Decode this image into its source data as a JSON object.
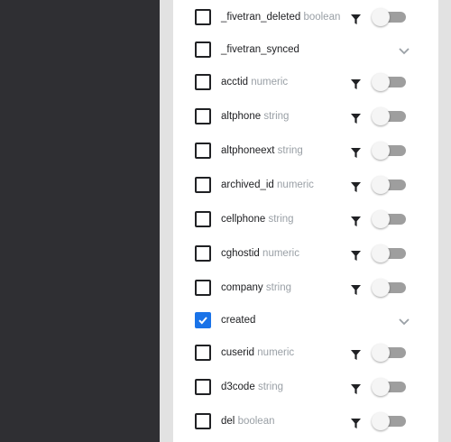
{
  "panel": {
    "rows": [
      {
        "name": "_fivetran_deleted",
        "type": "boolean",
        "checked": false,
        "control": "toggle",
        "filter_icon": "filter-icon"
      },
      {
        "name": "_fivetran_synced",
        "type": "",
        "checked": false,
        "control": "chevron",
        "filter_icon": ""
      },
      {
        "name": "acctid",
        "type": "numeric",
        "checked": false,
        "control": "toggle",
        "filter_icon": "filter-icon"
      },
      {
        "name": "altphone",
        "type": "string",
        "checked": false,
        "control": "toggle",
        "filter_icon": "filter-icon"
      },
      {
        "name": "altphoneext",
        "type": "string",
        "checked": false,
        "control": "toggle",
        "filter_icon": "filter-icon"
      },
      {
        "name": "archived_id",
        "type": "numeric",
        "checked": false,
        "control": "toggle",
        "filter_icon": "filter-icon"
      },
      {
        "name": "cellphone",
        "type": "string",
        "checked": false,
        "control": "toggle",
        "filter_icon": "filter-icon"
      },
      {
        "name": "cghostid",
        "type": "numeric",
        "checked": false,
        "control": "toggle",
        "filter_icon": "filter-icon"
      },
      {
        "name": "company",
        "type": "string",
        "checked": false,
        "control": "toggle",
        "filter_icon": "filter-icon"
      },
      {
        "name": "created",
        "type": "",
        "checked": true,
        "control": "chevron",
        "filter_icon": ""
      },
      {
        "name": "cuserid",
        "type": "numeric",
        "checked": false,
        "control": "toggle",
        "filter_icon": "filter-icon"
      },
      {
        "name": "d3code",
        "type": "string",
        "checked": false,
        "control": "toggle",
        "filter_icon": "filter-icon"
      },
      {
        "name": "del",
        "type": "boolean",
        "checked": false,
        "control": "toggle",
        "filter_icon": "filter-icon"
      }
    ]
  },
  "colors": {
    "sidebar_bg": "#2f2f33",
    "page_bg": "#e2e2e2",
    "panel_bg": "#ffffff",
    "checkbox_checked": "#1a73e8",
    "type_text": "#9aa0a6",
    "toggle_track": "#9e9e9e"
  }
}
